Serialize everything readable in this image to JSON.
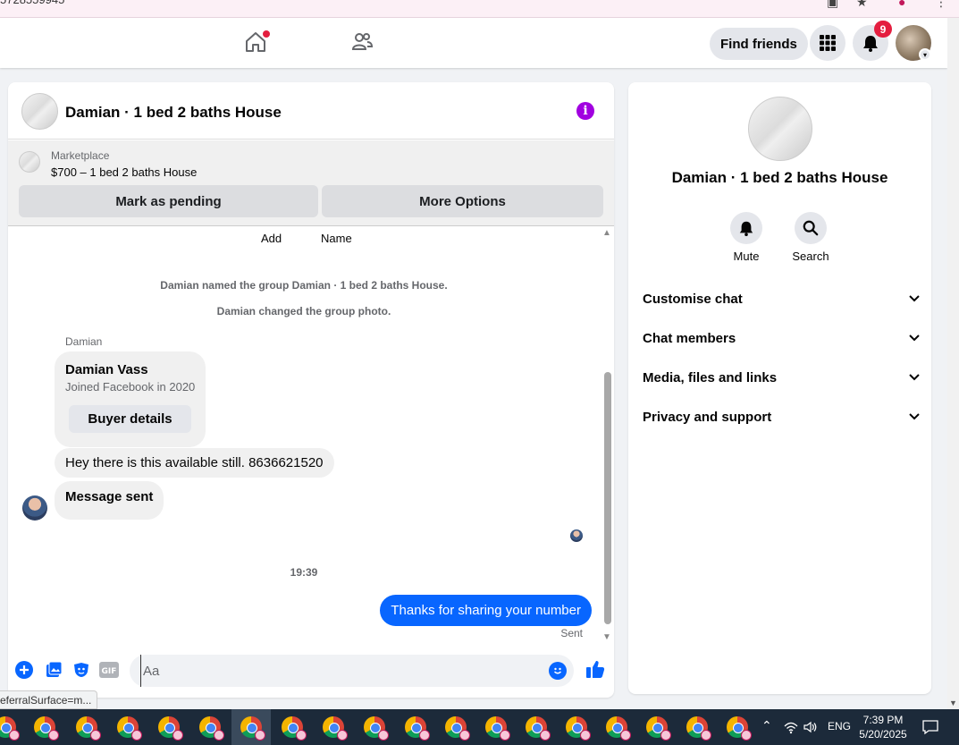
{
  "browser": {
    "url_fragment": "5728559945"
  },
  "nav": {
    "find_friends": "Find friends",
    "notification_count": "9"
  },
  "chat": {
    "title": "Damian · 1 bed 2 baths House",
    "marketplace_label": "Marketplace",
    "listing": "$700 – 1 bed 2 baths House",
    "mark_pending": "Mark as pending",
    "more_options": "More Options",
    "cut_add": "Add",
    "cut_name": "Name",
    "system_messages": [
      "Damian named the group Damian · 1 bed 2 baths House.",
      "Damian changed the group photo."
    ],
    "sender": "Damian",
    "card": {
      "name": "Damian Vass",
      "joined": "Joined Facebook in 2020",
      "button": "Buyer details"
    },
    "incoming": [
      "Hey there is this available still. 8636621520",
      "Message sent"
    ],
    "timestamp": "19:39",
    "outgoing": "Thanks for sharing your number",
    "status": "Sent",
    "composer_placeholder": "Aa"
  },
  "side": {
    "title": "Damian · 1 bed 2 baths House",
    "actions": [
      {
        "label": "Mute",
        "icon": "bell-icon"
      },
      {
        "label": "Search",
        "icon": "search-icon"
      }
    ],
    "sections": [
      "Customise chat",
      "Chat members",
      "Media, files and links",
      "Privacy and support"
    ]
  },
  "status_url": "eferralSurface=m...",
  "taskbar": {
    "language": "ENG",
    "time": "7:39 PM",
    "date": "5/20/2025"
  },
  "colors": {
    "accent": "#0866ff",
    "info": "#a100e0",
    "badge": "#e41e3f"
  }
}
